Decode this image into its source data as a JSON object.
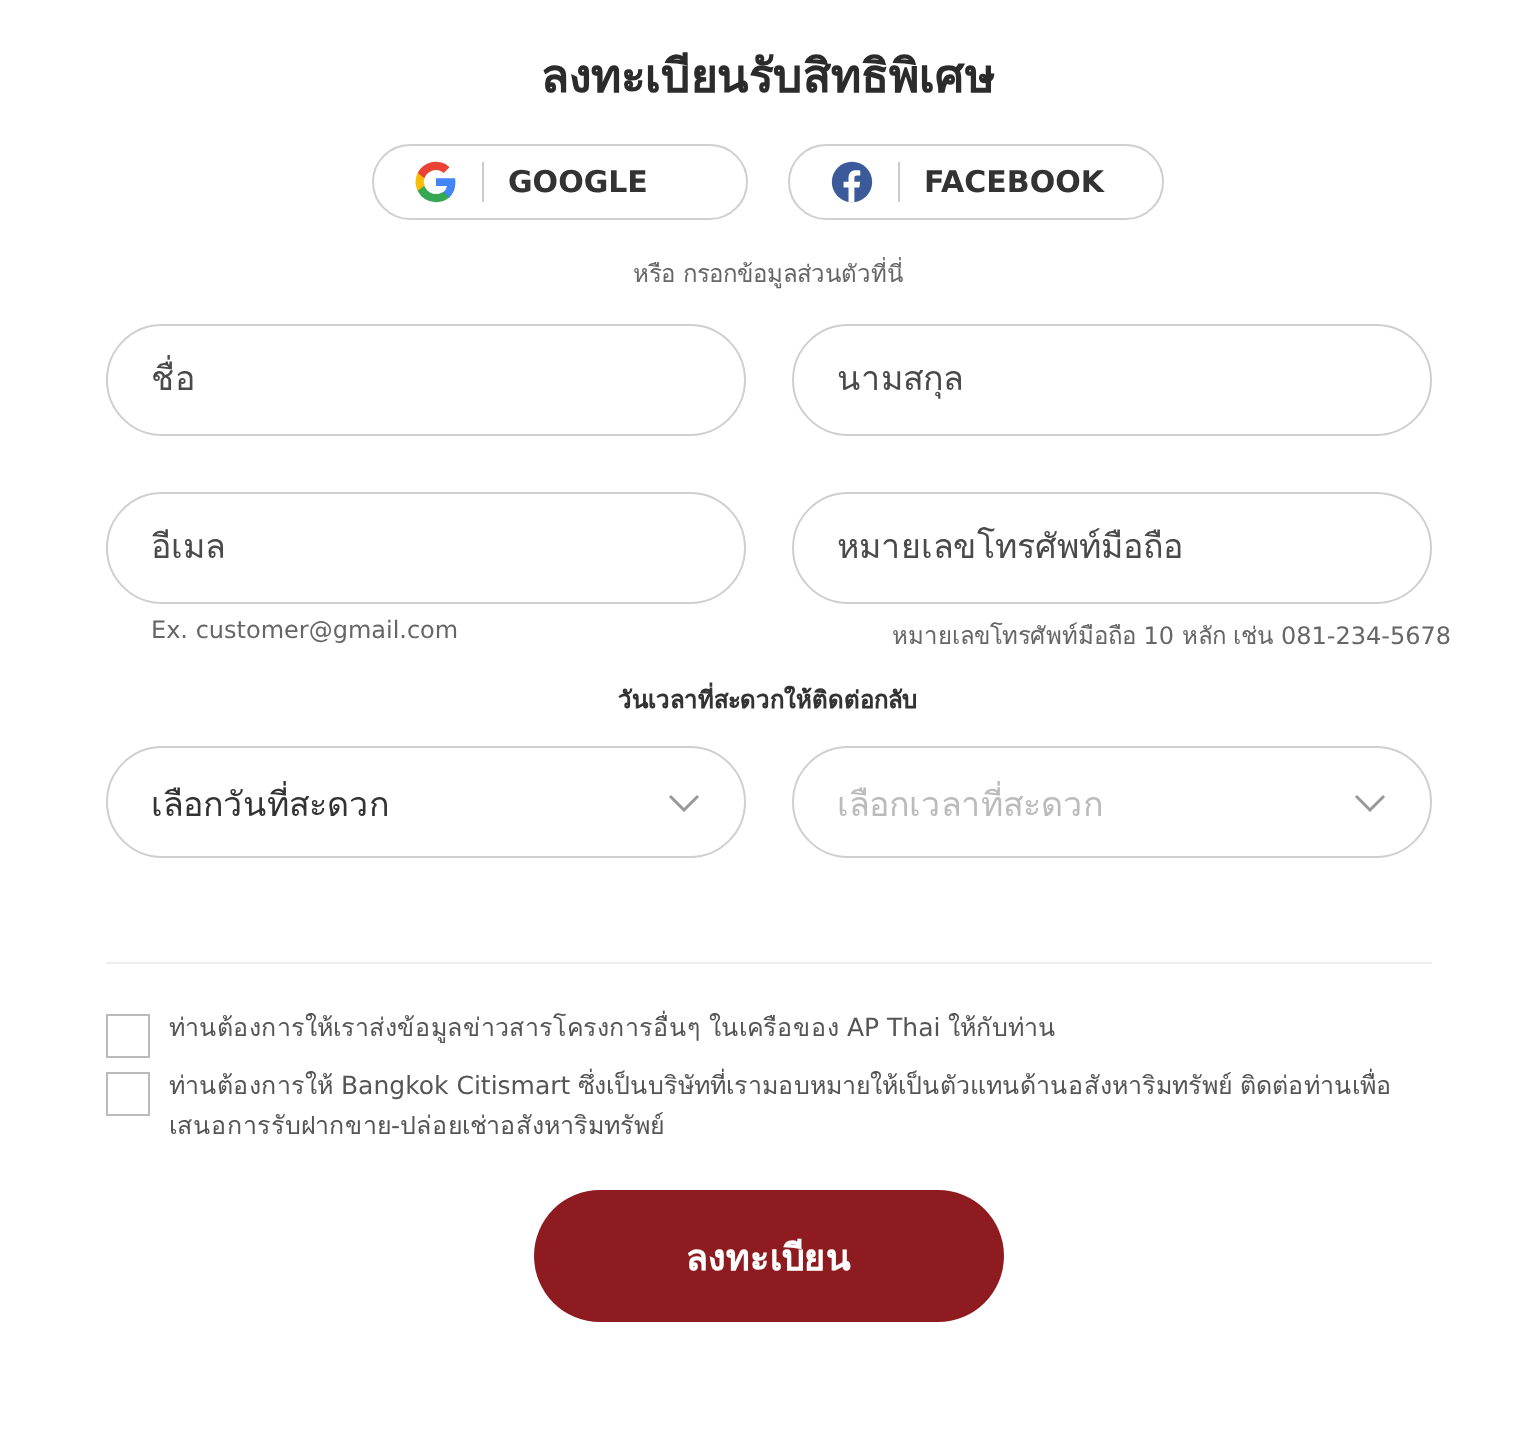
{
  "title": "ลงทะเบียนรับสิทธิพิเศษ",
  "social_buttons": [
    {
      "kind": "google",
      "label": "GOOGLE"
    },
    {
      "kind": "facebook",
      "label": "FACEBOOK"
    }
  ],
  "divider_text": "หรือ กรอกข้อมูลส่วนตัวที่นี่",
  "fields": [
    {
      "placeholder": "ชื่อ"
    },
    {
      "placeholder": "นามสกุล"
    },
    {
      "placeholder": "อีเมล",
      "hint": "Ex. customer@gmail.com"
    },
    {
      "placeholder": "หมายเลขโทรศัพท์มือถือ",
      "hint": "หมายเลขโทรศัพท์มือถือ 10 หลัก เช่น 081-234-5678"
    }
  ],
  "contact_time": {
    "label": "วันเวลาที่สะดวกให้ติดต่อกลับ",
    "selects": [
      {
        "value": "เลือกวันที่สะดวก",
        "disabled": false
      },
      {
        "value": "เลือกเวลาที่สะดวก",
        "disabled": true
      }
    ]
  },
  "consents": [
    {
      "label": "ท่านต้องการให้เราส่งข้อมูลข่าวสารโครงการอื่นๆ ในเครือของ AP Thai ให้กับท่าน",
      "checked": false
    },
    {
      "label": "ท่านต้องการให้ Bangkok Citismart ซึ่งเป็นบริษัทที่เรามอบหมายให้เป็นตัวแทนด้านอสังหาริมทรัพย์ ติดต่อท่านเพื่อเสนอการรับฝากขาย-ปล่อยเช่าอสังหาริมทรัพย์",
      "checked": false
    }
  ],
  "submit": "ลงทะเบียน"
}
